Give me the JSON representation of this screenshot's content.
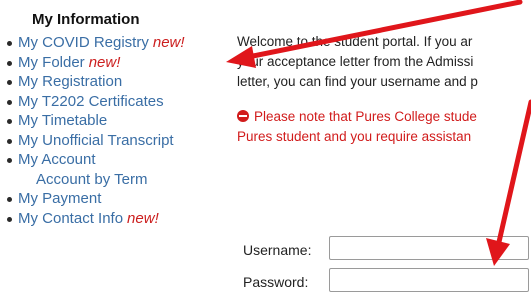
{
  "sidebar": {
    "title": "My Information",
    "items": [
      {
        "label": "My COVID Registry",
        "badge": "new!"
      },
      {
        "label": "My Folder",
        "badge": "new!"
      },
      {
        "label": "My Registration",
        "badge": ""
      },
      {
        "label": "My T2202 Certificates",
        "badge": ""
      },
      {
        "label": "My Timetable",
        "badge": ""
      },
      {
        "label": "My Unofficial Transcript",
        "badge": ""
      },
      {
        "label": "My Account",
        "badge": ""
      },
      {
        "label": "Account by Term",
        "badge": ""
      },
      {
        "label": "My Payment",
        "badge": ""
      },
      {
        "label": "My Contact Info",
        "badge": "new!"
      }
    ]
  },
  "main": {
    "welcome_text": "Welcome to the student portal. If you ar\nyour acceptance letter from the Admissi\nletter, you can find your username and p",
    "notice_text": "Please note that Pures College stude\nPures student and you require assistan"
  },
  "login": {
    "username_label": "Username:",
    "username_value": "",
    "password_label": "Password:",
    "password_value": ""
  },
  "colors": {
    "link": "#3a6ea5",
    "new_badge": "#cc1f1f",
    "notice": "#d11c1c",
    "annotation_arrow": "#e0161b"
  },
  "icons": {
    "notice": "no-entry-icon",
    "annotation": "red-arrow-icon"
  }
}
